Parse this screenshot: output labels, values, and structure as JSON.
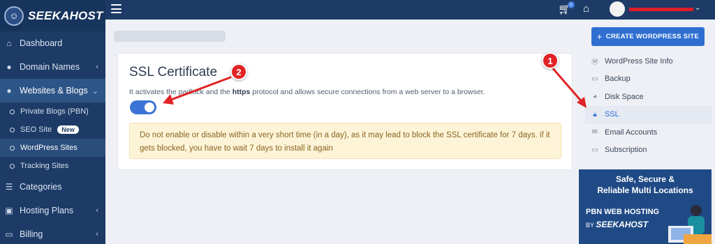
{
  "brand": {
    "name": "SEEKAHOST"
  },
  "sidebar": {
    "items": [
      {
        "label": "Dashboard",
        "icon": "home-icon"
      },
      {
        "label": "Domain Names",
        "icon": "globe-icon"
      },
      {
        "label": "Websites & Blogs",
        "icon": "globe-icon"
      }
    ],
    "sub_items": [
      {
        "label": "Private Blogs (PBN)"
      },
      {
        "label": "SEO Site",
        "badge": "New"
      },
      {
        "label": "WordPress Sites"
      },
      {
        "label": "Tracking Sites"
      }
    ],
    "bottom_items": [
      {
        "label": "Categories",
        "icon": "server-icon"
      },
      {
        "label": "Hosting Plans",
        "icon": "box-icon"
      },
      {
        "label": "Billing",
        "icon": "card-icon"
      }
    ]
  },
  "topbar": {
    "cart_count": "0"
  },
  "card": {
    "title": "SSL Certificate",
    "desc_before": "It activates the padlock and the ",
    "desc_bold": "https",
    "desc_after": " protocol and allows secure connections from a web server to a browser.",
    "toggle_on": true,
    "warning": "Do not enable or disable within a very short time (in a day), as it may lead to block the SSL certificate for 7 days. if it gets blocked, you have to wait 7 days to install it again"
  },
  "create_button": {
    "label": "CREATE WORDPRESS SITE"
  },
  "right_menu": [
    {
      "label": "WordPress Site Info",
      "icon": "wordpress-icon"
    },
    {
      "label": "Backup",
      "icon": "backup-icon"
    },
    {
      "label": "Disk Space",
      "icon": "pie-icon"
    },
    {
      "label": "SSL",
      "icon": "lock-icon"
    },
    {
      "label": "Email Accounts",
      "icon": "mail-icon"
    },
    {
      "label": "Subscription",
      "icon": "card-icon"
    }
  ],
  "banner": {
    "line1": "Safe, Secure &",
    "line2": "Reliable Multi Locations",
    "product": "PBN WEB HOSTING",
    "by": "BY",
    "brand": "SEEKAHOST"
  },
  "annotations": {
    "step1": "1",
    "step2": "2"
  },
  "colors": {
    "sidebar": "#1d3b66",
    "accent": "#2f6fd1",
    "warning_bg": "#fdf4d8",
    "annotation": "#e02426"
  }
}
